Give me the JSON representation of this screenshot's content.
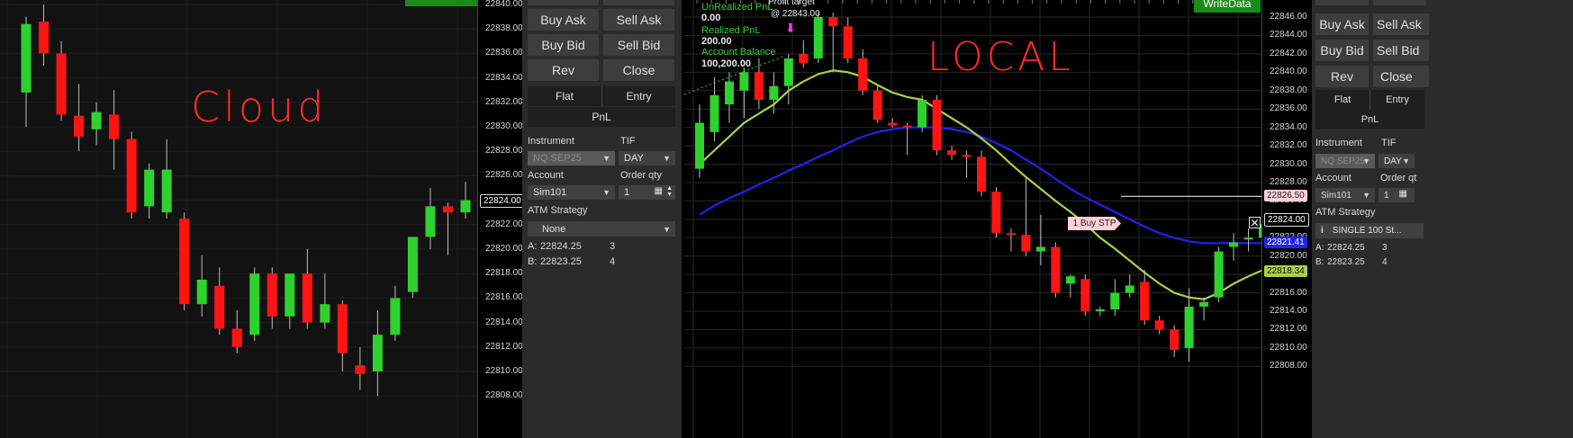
{
  "annotations": {
    "left": "Cloud",
    "right": "LOCAL"
  },
  "cloud_axis": {
    "ticks": [
      "22840.00",
      "22838.00",
      "22836.00",
      "22834.00",
      "22832.00",
      "22830.00",
      "22828.00",
      "22826.00",
      "22824.00",
      "22822.00",
      "22820.00",
      "22818.00",
      "22816.00",
      "22814.00",
      "22812.00",
      "22810.00",
      "22808.00"
    ],
    "current_price": "22824.00"
  },
  "local_axis": {
    "ticks": [
      "22846.00",
      "22844.00",
      "22842.00",
      "22840.00",
      "22838.00",
      "22836.00",
      "22834.00",
      "22832.00",
      "22830.00",
      "22828.00",
      "22826.00",
      "22824.00",
      "22822.00",
      "22820.00",
      "22818.00",
      "22816.00",
      "22814.00",
      "22812.00",
      "22810.00",
      "22808.00"
    ],
    "flags": {
      "order": "22826.50",
      "last": "22824.00",
      "slow_ma": "22821.41",
      "fast_ma": "22818.34"
    }
  },
  "chart_overlay": {
    "unrealized_label": "UnRealized PnL",
    "unrealized_value": "0.00",
    "realized_label": "Realized PnL",
    "realized_value": "200.00",
    "balance_label": "Account Balance",
    "balance_value": "100,200.00",
    "profit_target_label": "Profit target",
    "profit_target_value": "@ 22843.00",
    "order_tag": "1  Buy STP",
    "write_button": "WriteData"
  },
  "order_panel_left": {
    "buy_ask": "Buy Ask",
    "sell_ask": "Sell Ask",
    "buy_bid": "Buy Bid",
    "sell_bid": "Sell Bid",
    "rev": "Rev",
    "close": "Close",
    "flat": "Flat",
    "entry": "Entry",
    "pnl": "PnL",
    "instrument_label": "Instrument",
    "instrument_value": "NQ SEP25",
    "tif_label": "TIF",
    "tif_value": "DAY",
    "account_label": "Account",
    "account_value": "Sim101",
    "order_qty_label": "Order qty",
    "order_qty_value": "1",
    "atm_label": "ATM Strategy",
    "atm_value": "None",
    "ask_label": "A:",
    "ask_price": "22824.25",
    "ask_size": "3",
    "bid_label": "B:",
    "bid_price": "22823.25",
    "bid_size": "4"
  },
  "order_panel_right": {
    "buy_ask": "Buy Ask",
    "sell_ask": "Sell Ask",
    "buy_bid": "Buy Bid",
    "sell_bid": "Sell Bid",
    "rev": "Rev",
    "close": "Close",
    "flat": "Flat",
    "entry": "Entry",
    "pnl": "PnL",
    "instrument_label": "Instrument",
    "instrument_value": "NQ SEP25",
    "tif_label": "TIF",
    "tif_value": "DAY",
    "account_label": "Account",
    "account_value": "Sim101",
    "order_qty_label": "Order qt",
    "order_qty_value": "1",
    "atm_label": "ATM Strategy",
    "atm_value": "SINGLE 100 St...",
    "ask_label": "A:",
    "ask_price": "22824.25",
    "ask_size": "3",
    "bid_label": "B:",
    "bid_price": "22823.25",
    "bid_size": "4"
  },
  "colors": {
    "up": "#2fd12f",
    "down": "#ff1414",
    "fast_ma": "#a8d14a",
    "slow_ma": "#2222ee",
    "order_line": "#ffd0d8",
    "overlay_text": "#2fd12f"
  },
  "cloud_candles": [
    {
      "o": 22832.8,
      "h": 22839.0,
      "l": 22830.0,
      "c": 22838.4
    },
    {
      "o": 22838.6,
      "h": 22840.0,
      "l": 22835.0,
      "c": 22836.0
    },
    {
      "o": 22836.0,
      "h": 22837.0,
      "l": 22830.5,
      "c": 22831.0
    },
    {
      "o": 22830.9,
      "h": 22833.5,
      "l": 22828.0,
      "c": 22829.2
    },
    {
      "o": 22829.8,
      "h": 22832.0,
      "l": 22828.5,
      "c": 22831.2
    },
    {
      "o": 22831.0,
      "h": 22833.0,
      "l": 22826.5,
      "c": 22829.0
    },
    {
      "o": 22829.0,
      "h": 22829.6,
      "l": 22822.5,
      "c": 22823.0
    },
    {
      "o": 22823.5,
      "h": 22827.0,
      "l": 22822.5,
      "c": 22826.5
    },
    {
      "o": 22823.0,
      "h": 22829.0,
      "l": 22822.5,
      "c": 22826.5
    },
    {
      "o": 22822.5,
      "h": 22823.0,
      "l": 22815.0,
      "c": 22815.5
    },
    {
      "o": 22815.5,
      "h": 22819.5,
      "l": 22814.5,
      "c": 22817.5
    },
    {
      "o": 22817.0,
      "h": 22818.5,
      "l": 22813.0,
      "c": 22813.5
    },
    {
      "o": 22813.5,
      "h": 22815.0,
      "l": 22811.5,
      "c": 22812.0
    },
    {
      "o": 22813.0,
      "h": 22818.5,
      "l": 22812.5,
      "c": 22818.0
    },
    {
      "o": 22818.0,
      "h": 22818.5,
      "l": 22813.5,
      "c": 22814.5
    },
    {
      "o": 22814.5,
      "h": 22818.0,
      "l": 22813.5,
      "c": 22818.0
    },
    {
      "o": 22818.0,
      "h": 22820.0,
      "l": 22813.5,
      "c": 22814.0
    },
    {
      "o": 22814.0,
      "h": 22818.0,
      "l": 22813.5,
      "c": 22815.5
    },
    {
      "o": 22815.5,
      "h": 22815.8,
      "l": 22810.0,
      "c": 22811.5
    },
    {
      "o": 22810.5,
      "h": 22812.0,
      "l": 22808.5,
      "c": 22809.8
    },
    {
      "o": 22810.0,
      "h": 22815.0,
      "l": 22808.0,
      "c": 22813.0
    },
    {
      "o": 22813.0,
      "h": 22817.0,
      "l": 22812.5,
      "c": 22816.0
    },
    {
      "o": 22816.5,
      "h": 22821.0,
      "l": 22816.0,
      "c": 22821.0
    },
    {
      "o": 22821.0,
      "h": 22825.0,
      "l": 22820.0,
      "c": 22823.5
    },
    {
      "o": 22823.5,
      "h": 22823.8,
      "l": 22819.5,
      "c": 22823.0
    },
    {
      "o": 22823.0,
      "h": 22825.5,
      "l": 22822.5,
      "c": 22824.0
    }
  ],
  "local_candles": [
    {
      "o": 22829.5,
      "h": 22836.5,
      "l": 22828.5,
      "c": 22834.5
    },
    {
      "o": 22833.5,
      "h": 22839.5,
      "l": 22832.5,
      "c": 22837.5
    },
    {
      "o": 22836.5,
      "h": 22840.0,
      "l": 22834.5,
      "c": 22839.0
    },
    {
      "o": 22838.0,
      "h": 22840.5,
      "l": 22835.0,
      "c": 22840.0
    },
    {
      "o": 22840.0,
      "h": 22841.5,
      "l": 22836.0,
      "c": 22837.0
    },
    {
      "o": 22837.0,
      "h": 22840.0,
      "l": 22835.5,
      "c": 22838.5
    },
    {
      "o": 22838.5,
      "h": 22842.0,
      "l": 22836.5,
      "c": 22841.5
    },
    {
      "o": 22842.0,
      "h": 22843.5,
      "l": 22840.5,
      "c": 22841.0
    },
    {
      "o": 22841.5,
      "h": 22846.5,
      "l": 22841.0,
      "c": 22846.0
    },
    {
      "o": 22846.0,
      "h": 22846.5,
      "l": 22840.0,
      "c": 22845.0
    },
    {
      "o": 22845.0,
      "h": 22846.0,
      "l": 22841.0,
      "c": 22841.5
    },
    {
      "o": 22841.5,
      "h": 22842.5,
      "l": 22837.5,
      "c": 22838.0
    },
    {
      "o": 22838.0,
      "h": 22838.5,
      "l": 22834.5,
      "c": 22834.8
    },
    {
      "o": 22834.5,
      "h": 22835.0,
      "l": 22834.0,
      "c": 22834.2
    },
    {
      "o": 22834.2,
      "h": 22834.5,
      "l": 22831.0,
      "c": 22834.0
    },
    {
      "o": 22834.0,
      "h": 22837.5,
      "l": 22833.5,
      "c": 22837.0
    },
    {
      "o": 22837.0,
      "h": 22837.5,
      "l": 22831.0,
      "c": 22831.5
    },
    {
      "o": 22831.5,
      "h": 22832.0,
      "l": 22830.5,
      "c": 22831.0
    },
    {
      "o": 22831.0,
      "h": 22831.5,
      "l": 22828.5,
      "c": 22830.8
    },
    {
      "o": 22830.8,
      "h": 22831.5,
      "l": 22826.5,
      "c": 22827.0
    },
    {
      "o": 22827.0,
      "h": 22827.5,
      "l": 22822.0,
      "c": 22822.5
    },
    {
      "o": 22822.5,
      "h": 22823.0,
      "l": 22820.5,
      "c": 22822.3
    },
    {
      "o": 22822.3,
      "h": 22828.5,
      "l": 22820.0,
      "c": 22820.5
    },
    {
      "o": 22820.5,
      "h": 22824.5,
      "l": 22819.0,
      "c": 22821.0
    },
    {
      "o": 22821.0,
      "h": 22821.5,
      "l": 22815.5,
      "c": 22816.0
    },
    {
      "o": 22817.0,
      "h": 22818.0,
      "l": 22815.5,
      "c": 22817.8
    },
    {
      "o": 22817.5,
      "h": 22818.0,
      "l": 22813.5,
      "c": 22814.0
    },
    {
      "o": 22814.0,
      "h": 22814.5,
      "l": 22813.5,
      "c": 22814.2
    },
    {
      "o": 22814.2,
      "h": 22817.5,
      "l": 22813.5,
      "c": 22816.0
    },
    {
      "o": 22816.0,
      "h": 22818.0,
      "l": 22815.5,
      "c": 22816.8
    },
    {
      "o": 22817.2,
      "h": 22818.5,
      "l": 22812.5,
      "c": 22813.0
    },
    {
      "o": 22813.0,
      "h": 22813.5,
      "l": 22811.5,
      "c": 22812.0
    },
    {
      "o": 22812.0,
      "h": 22812.5,
      "l": 22809.0,
      "c": 22809.8
    },
    {
      "o": 22810.0,
      "h": 22816.5,
      "l": 22808.5,
      "c": 22814.5
    },
    {
      "o": 22814.5,
      "h": 22815.5,
      "l": 22813.0,
      "c": 22815.0
    },
    {
      "o": 22815.5,
      "h": 22821.0,
      "l": 22815.0,
      "c": 22820.5
    },
    {
      "o": 22821.0,
      "h": 22822.5,
      "l": 22819.5,
      "c": 22821.5
    },
    {
      "o": 22821.8,
      "h": 22823.0,
      "l": 22820.5,
      "c": 22822.0
    },
    {
      "o": 22822.0,
      "h": 22823.5,
      "l": 22820.0,
      "c": 22823.5
    }
  ],
  "local_fast_ma": [
    22830.0,
    22831.5,
    22833.0,
    22834.5,
    22835.5,
    22836.5,
    22838.0,
    22839.0,
    22839.8,
    22840.2,
    22840.0,
    22839.5,
    22838.6,
    22837.8,
    22837.3,
    22837.0,
    22836.0,
    22835.0,
    22834.0,
    22832.8,
    22831.5,
    22830.0,
    22828.6,
    22827.3,
    22826.0,
    22824.8,
    22823.5,
    22822.0,
    22820.8,
    22819.5,
    22818.2,
    22817.0,
    22816.0,
    22815.5,
    22815.3,
    22816.0,
    22817.0,
    22817.8,
    22818.5
  ],
  "local_slow_ma": [
    22824.5,
    22825.5,
    22826.3,
    22827.0,
    22827.8,
    22828.5,
    22829.3,
    22830.0,
    22830.8,
    22831.5,
    22832.3,
    22833.0,
    22833.5,
    22833.8,
    22834.0,
    22834.0,
    22834.0,
    22833.8,
    22833.5,
    22833.0,
    22832.3,
    22831.5,
    22830.5,
    22829.5,
    22828.4,
    22827.3,
    22826.4,
    22825.6,
    22824.8,
    22824.0,
    22823.2,
    22822.5,
    22822.0,
    22821.6,
    22821.4,
    22821.4,
    22821.4,
    22821.4,
    22821.4
  ]
}
